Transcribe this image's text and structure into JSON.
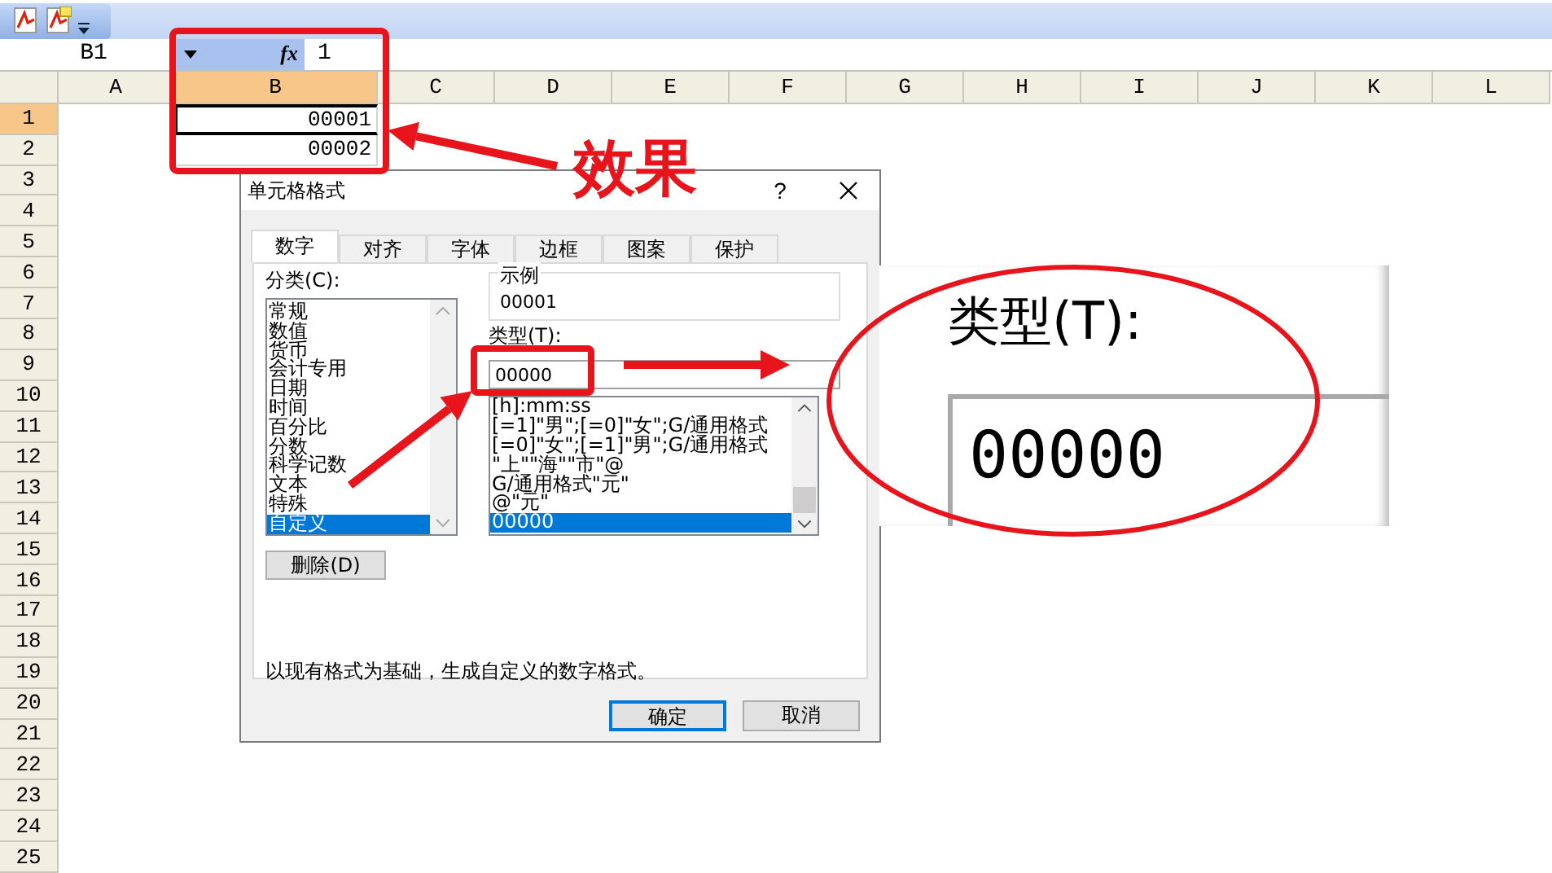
{
  "formula_bar": {
    "name_box": "B1",
    "fx": "fx",
    "value": "1"
  },
  "sheet": {
    "columns": [
      {
        "label": "A",
        "selected": false
      },
      {
        "label": "B",
        "selected": true
      },
      {
        "label": "C",
        "selected": false
      },
      {
        "label": "D",
        "selected": false
      },
      {
        "label": "E",
        "selected": false
      },
      {
        "label": "F",
        "selected": false
      },
      {
        "label": "G",
        "selected": false
      },
      {
        "label": "H",
        "selected": false
      },
      {
        "label": "I",
        "selected": false
      },
      {
        "label": "J",
        "selected": false
      },
      {
        "label": "K",
        "selected": false
      },
      {
        "label": "L",
        "selected": false
      }
    ],
    "rows": [
      {
        "label": "1",
        "selected": true,
        "column_b": "00001"
      },
      {
        "label": "2",
        "selected": false,
        "column_b": "00002"
      },
      {
        "label": "3",
        "selected": false
      },
      {
        "label": "4",
        "selected": false
      },
      {
        "label": "5",
        "selected": false
      },
      {
        "label": "6",
        "selected": false
      },
      {
        "label": "7",
        "selected": false
      },
      {
        "label": "8",
        "selected": false
      },
      {
        "label": "9",
        "selected": false
      },
      {
        "label": "10",
        "selected": false
      },
      {
        "label": "11",
        "selected": false
      },
      {
        "label": "12",
        "selected": false
      },
      {
        "label": "13",
        "selected": false
      },
      {
        "label": "14",
        "selected": false
      },
      {
        "label": "15",
        "selected": false
      },
      {
        "label": "16",
        "selected": false
      },
      {
        "label": "17",
        "selected": false
      },
      {
        "label": "18",
        "selected": false
      },
      {
        "label": "19",
        "selected": false
      },
      {
        "label": "20",
        "selected": false
      },
      {
        "label": "21",
        "selected": false
      },
      {
        "label": "22",
        "selected": false
      },
      {
        "label": "23",
        "selected": false
      },
      {
        "label": "24",
        "selected": false
      },
      {
        "label": "25",
        "selected": false
      }
    ]
  },
  "dialog": {
    "title": "单元格格式",
    "help": "?",
    "tabs": [
      {
        "label": "数字",
        "selected": true
      },
      {
        "label": "对齐",
        "selected": false
      },
      {
        "label": "字体",
        "selected": false
      },
      {
        "label": "边框",
        "selected": false
      },
      {
        "label": "图案",
        "selected": false
      },
      {
        "label": "保护",
        "selected": false
      }
    ],
    "category": {
      "label": "分类(C):",
      "items": [
        {
          "label": "常规",
          "selected": false
        },
        {
          "label": "数值",
          "selected": false
        },
        {
          "label": "货币",
          "selected": false
        },
        {
          "label": "会计专用",
          "selected": false
        },
        {
          "label": "日期",
          "selected": false
        },
        {
          "label": "时间",
          "selected": false
        },
        {
          "label": "百分比",
          "selected": false
        },
        {
          "label": "分数",
          "selected": false
        },
        {
          "label": "科学记数",
          "selected": false
        },
        {
          "label": "文本",
          "selected": false
        },
        {
          "label": "特殊",
          "selected": false
        },
        {
          "label": "自定义",
          "selected": true
        }
      ]
    },
    "sample": {
      "label": "示例",
      "value": "00001"
    },
    "type": {
      "label": "类型(T):",
      "value": "00000",
      "formats": [
        {
          "text": "[h]:mm:ss",
          "selected": false
        },
        {
          "text": "[=1]\"男\";[=0]\"女\";G/通用格式",
          "selected": false
        },
        {
          "text": "[=0]\"女\";[=1]\"男\";G/通用格式",
          "selected": false
        },
        {
          "text": "\"上\"\"海\"\"市\"@",
          "selected": false
        },
        {
          "text": "G/通用格式\"元\"",
          "selected": false
        },
        {
          "text": "@\"元\"",
          "selected": false
        },
        {
          "text": "00000",
          "selected": true
        }
      ]
    },
    "delete_button": "删除(D)",
    "description": "以现有格式为基础，生成自定义的数字格式。",
    "buttons": [
      {
        "label": "确定",
        "default": true
      },
      {
        "label": "取消",
        "default": false
      }
    ]
  },
  "callout": {
    "text": "效果"
  },
  "magnifier": {
    "label": "类型(T):",
    "value": "00000"
  }
}
